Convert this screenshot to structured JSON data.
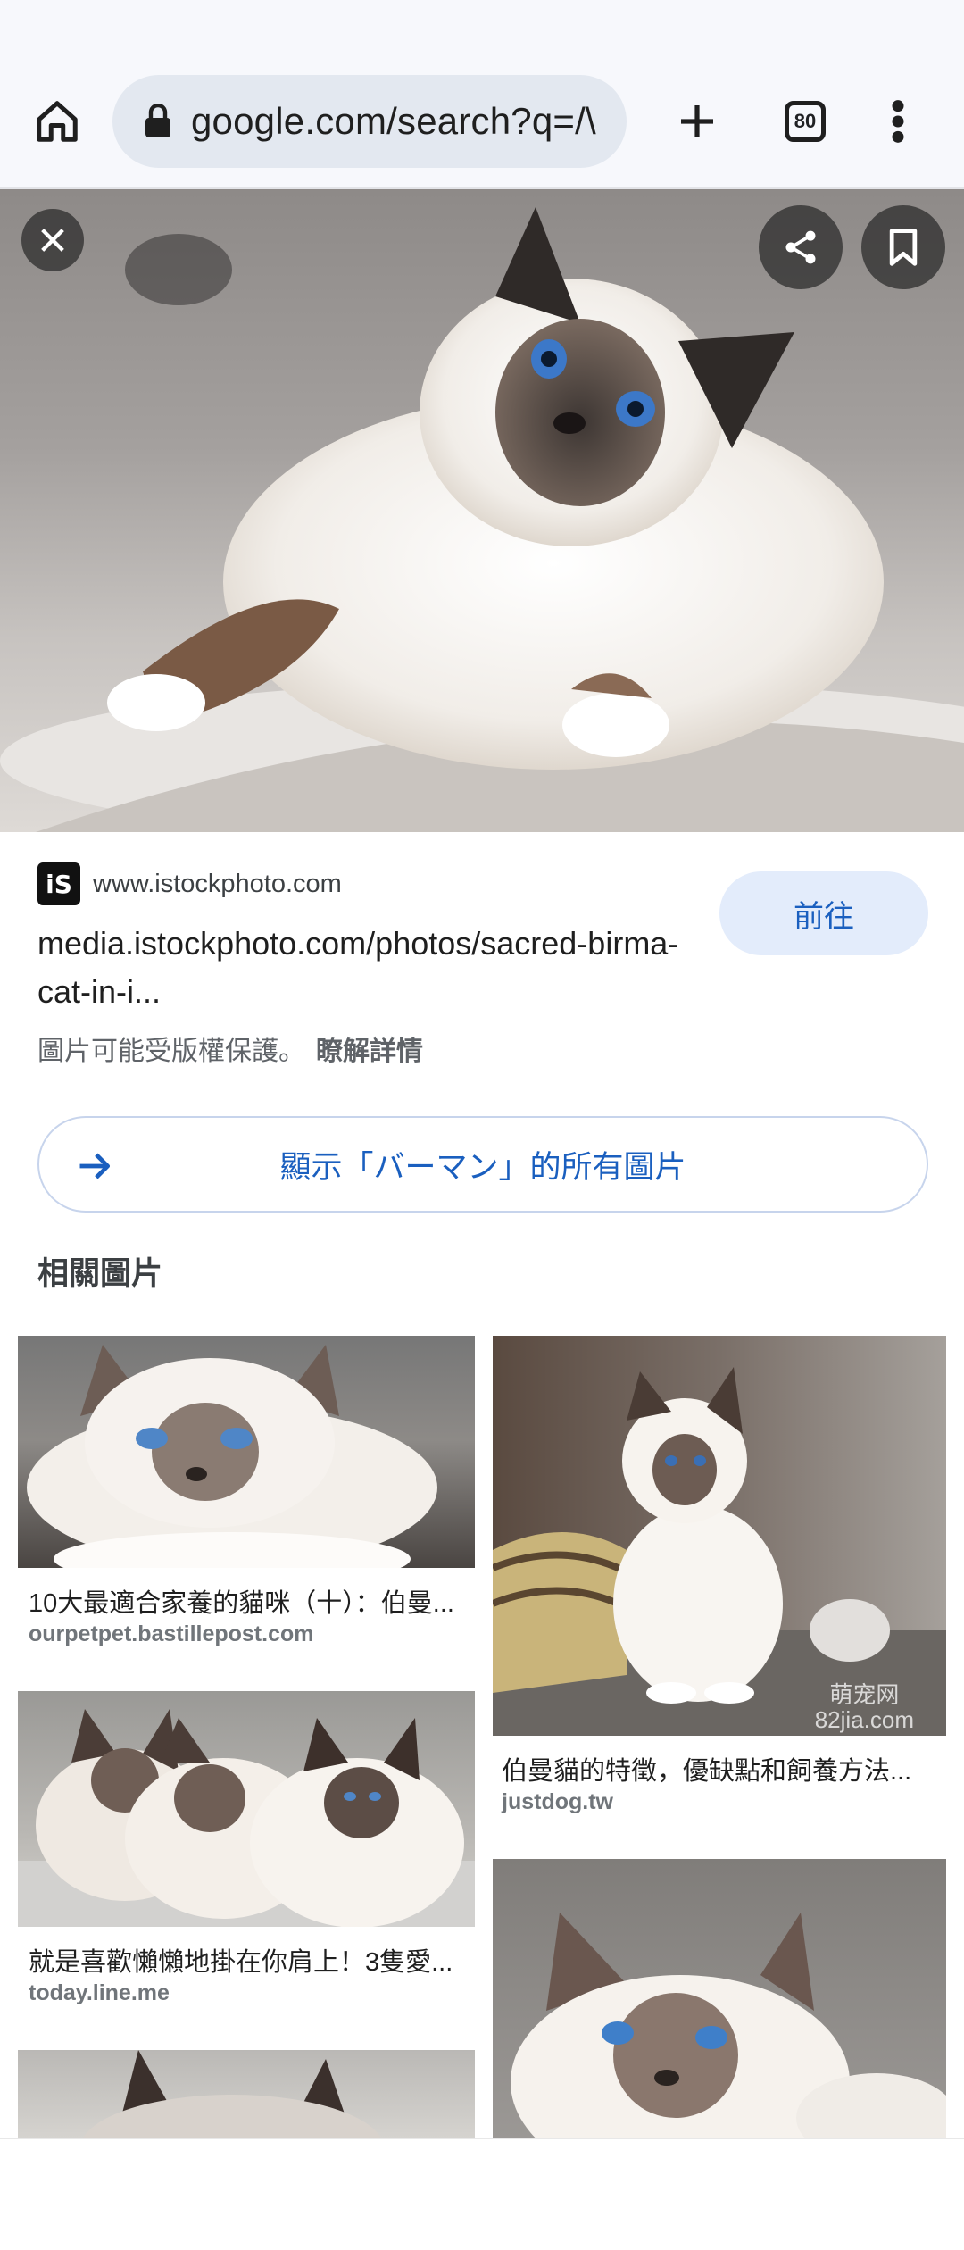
{
  "browser": {
    "url": "google.com/search?q=/\\",
    "tab_count": "80",
    "icons": [
      "home-icon",
      "lock-icon",
      "new-tab-icon",
      "tab-switcher-icon",
      "more-vert-icon"
    ]
  },
  "viewer": {
    "icons": [
      "close-icon",
      "share-icon",
      "bookmark-icon"
    ]
  },
  "result": {
    "source_domain": "www.istockphoto.com",
    "favicon_text": "iS",
    "visit_label": "前往",
    "page_url": "media.istockphoto.com/photos/sacred-birma-cat-in-i...",
    "copyright_notice": "圖片可能受版權保護。",
    "learn_more": "瞭解詳情"
  },
  "show_all": {
    "label": "顯示「バーマン」的所有圖片"
  },
  "related": {
    "heading": "相關圖片",
    "items": [
      {
        "title": "10大最適合家養的貓咪（十）：伯曼...",
        "source": "ourpetpet.bastillepost.com"
      },
      {
        "title": "伯曼貓的特徵，優缺點和飼養方法...",
        "source": "justdog.tw",
        "watermark": "萌宠网\n82jia.com"
      },
      {
        "title": "就是喜歡懶懶地掛在你肩上！3隻愛...",
        "source": "today.line.me"
      },
      {
        "title": "",
        "source": ""
      },
      {
        "title": "",
        "source": ""
      }
    ]
  },
  "colors": {
    "accent_blue": "#1a5fbf",
    "visit_bg": "#e3ecfb",
    "toolbar_bg": "#f7f8fc",
    "omnibox_bg": "#e3e8f0"
  }
}
